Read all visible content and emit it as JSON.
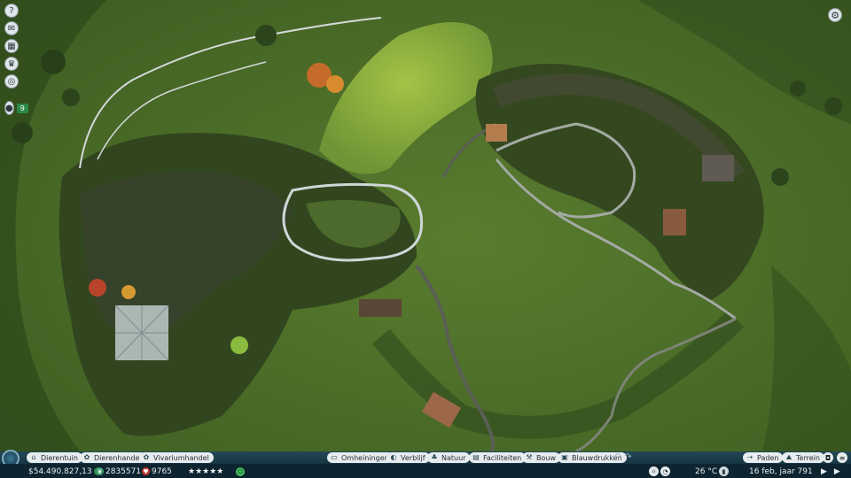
{
  "left_toolbar": {
    "buttons": [
      {
        "name": "help",
        "icon": "question-icon",
        "glyph": "?"
      },
      {
        "name": "messages",
        "icon": "inbox-icon",
        "glyph": "✉"
      },
      {
        "name": "management",
        "icon": "calendar-icon",
        "glyph": "▦"
      },
      {
        "name": "challenges",
        "icon": "trophy-icon",
        "glyph": "♛"
      },
      {
        "name": "objectives",
        "icon": "target-icon",
        "glyph": "◎"
      }
    ],
    "guests": {
      "icon": "person-icon",
      "glyph": "●",
      "count": "9"
    }
  },
  "top_right": {
    "settings_icon": "gear-icon",
    "glyph": "⚙"
  },
  "bottom_tabs": {
    "left": [
      {
        "label": "Dierentuin",
        "icon": "zoo-icon",
        "glyph": "⌂"
      },
      {
        "label": "Dierenhandel",
        "icon": "paw-icon",
        "glyph": "✿"
      },
      {
        "label": "Vivariumhandel",
        "icon": "lizard-icon",
        "glyph": "✿"
      }
    ],
    "center": [
      {
        "label": "Omheiningen",
        "icon": "fence-icon",
        "glyph": "▭"
      },
      {
        "label": "Verblijf",
        "icon": "habitat-icon",
        "glyph": "◐"
      },
      {
        "label": "Natuur",
        "icon": "tree-icon",
        "glyph": "♣"
      },
      {
        "label": "Faciliteiten",
        "icon": "shop-icon",
        "glyph": "▤"
      },
      {
        "label": "Bouw",
        "icon": "hammer-icon",
        "glyph": "⚒"
      },
      {
        "label": "Blauwdrukken",
        "icon": "blueprint-icon",
        "glyph": "▣"
      }
    ],
    "right": [
      {
        "label": "Paden",
        "icon": "path-icon",
        "glyph": "⇢"
      },
      {
        "label": "Terrein",
        "icon": "terrain-icon",
        "glyph": "⛰"
      }
    ]
  },
  "status_bar": {
    "money": "$54.490.827,13",
    "money_icon": "plus-icon",
    "conservation_credits": "2835571",
    "credits_icon": "leaf-icon",
    "guests": "9765",
    "guest_icon": "heart-icon",
    "rating_stars": 5,
    "happiness_icon": "smiley-icon",
    "temperature": "26 °C",
    "date": "16 feb, jaar 791"
  },
  "colors": {
    "grass": "#4a6b2a",
    "path": "#9aa19a",
    "ui_bar": "#183642",
    "accent_green": "#2d8a49"
  }
}
